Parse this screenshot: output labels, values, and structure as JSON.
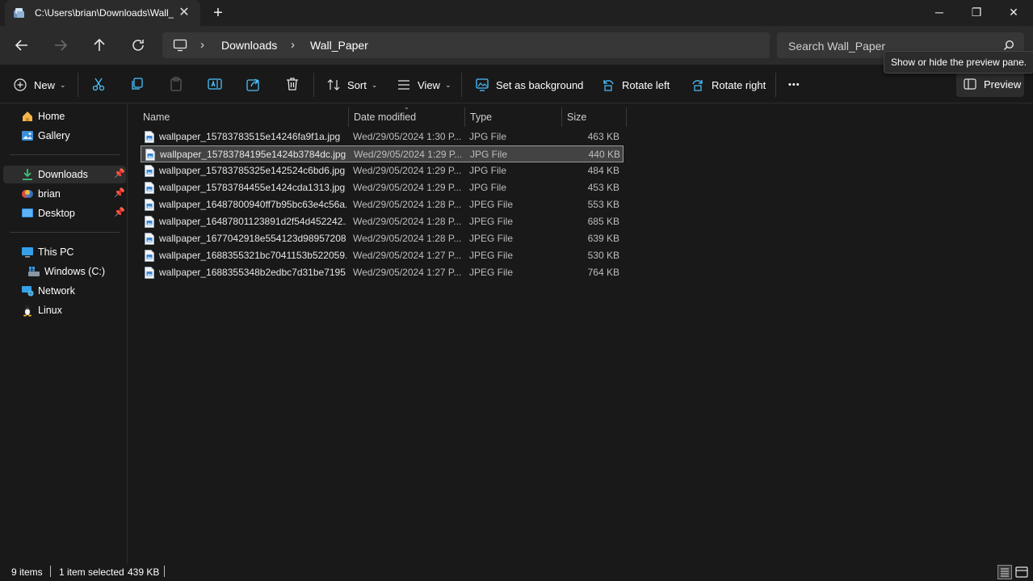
{
  "window": {
    "tab_title": "C:\\Users\\brian\\Downloads\\Wall_Paper",
    "tab_close": "✕",
    "new_tab": "+",
    "minimize": "─",
    "maximize": "❐",
    "close": "✕"
  },
  "address": {
    "separator": "›",
    "segments": [
      "Downloads",
      "Wall_Paper"
    ]
  },
  "search": {
    "placeholder": "Search Wall_Paper"
  },
  "tooltip": "Show or hide the preview pane.",
  "commands": {
    "new": "New",
    "sort": "Sort",
    "view": "View",
    "set_background": "Set as background",
    "rotate_left": "Rotate left",
    "rotate_right": "Rotate right",
    "more": "•••",
    "preview": "Preview",
    "caret": "⌄"
  },
  "sidebar": {
    "pin": "📌",
    "items": [
      {
        "label": "Home",
        "icon": "home-icon"
      },
      {
        "label": "Gallery",
        "icon": "gallery-icon"
      },
      {
        "label": "Downloads",
        "icon": "download-icon",
        "pinned": true,
        "active": true
      },
      {
        "label": "brian",
        "icon": "user-folder-icon",
        "pinned": true
      },
      {
        "label": "Desktop",
        "icon": "desktop-icon",
        "pinned": true
      },
      {
        "label": "This PC",
        "icon": "pc-icon"
      },
      {
        "label": "Windows (C:)",
        "icon": "drive-icon"
      },
      {
        "label": "Network",
        "icon": "network-icon"
      },
      {
        "label": "Linux",
        "icon": "linux-icon"
      }
    ]
  },
  "columns": {
    "name": "Name",
    "date": "Date modified",
    "type": "Type",
    "size": "Size"
  },
  "files": [
    {
      "name": "wallpaper_15783783515e14246fa9f1a.jpg",
      "date": "Wed/29/05/2024 1:30 P...",
      "type": "JPG File",
      "size": "463 KB"
    },
    {
      "name": "wallpaper_15783784195e1424b3784dc.jpg",
      "date": "Wed/29/05/2024 1:29 P...",
      "type": "JPG File",
      "size": "440 KB",
      "selected": true
    },
    {
      "name": "wallpaper_15783785325e142524c6bd6.jpg",
      "date": "Wed/29/05/2024 1:29 P...",
      "type": "JPG File",
      "size": "484 KB"
    },
    {
      "name": "wallpaper_15783784455e1424cda1313.jpg",
      "date": "Wed/29/05/2024 1:29 P...",
      "type": "JPG File",
      "size": "453 KB"
    },
    {
      "name": "wallpaper_16487800940ff7b95bc63e4c56a...",
      "date": "Wed/29/05/2024 1:28 P...",
      "type": "JPEG File",
      "size": "553 KB"
    },
    {
      "name": "wallpaper_16487801123891d2f54d452242...",
      "date": "Wed/29/05/2024 1:28 P...",
      "type": "JPEG File",
      "size": "685 KB"
    },
    {
      "name": "wallpaper_1677042918e554123d98957208...",
      "date": "Wed/29/05/2024 1:28 P...",
      "type": "JPEG File",
      "size": "639 KB"
    },
    {
      "name": "wallpaper_1688355321bc7041153b522059...",
      "date": "Wed/29/05/2024 1:27 P...",
      "type": "JPEG File",
      "size": "530 KB"
    },
    {
      "name": "wallpaper_1688355348b2edbc7d31be7195...",
      "date": "Wed/29/05/2024 1:27 P...",
      "type": "JPEG File",
      "size": "764 KB"
    }
  ],
  "status": {
    "items": "9 items",
    "selected": "1 item selected",
    "selected_size": "439 KB"
  },
  "colors": {
    "accent": "#4cc2ff",
    "background": "#191919",
    "selection": "#434343"
  }
}
